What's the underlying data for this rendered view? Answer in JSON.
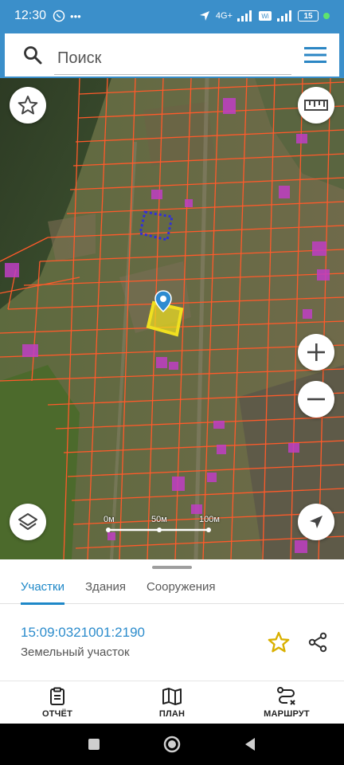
{
  "status_bar": {
    "time": "12:30",
    "network_label": "4G+",
    "battery_level": "15"
  },
  "search": {
    "placeholder": "Поиск"
  },
  "map": {
    "scale": {
      "labels": [
        "0м",
        "50м",
        "100м"
      ]
    },
    "selected_parcel_color": "#f0e020",
    "parcel_border_color": "#ff5a2a",
    "highlight_color": "#c03ec4"
  },
  "tabs": {
    "items": [
      "Участки",
      "Здания",
      "Сооружения"
    ],
    "active": "Участки"
  },
  "parcel": {
    "cadastral_number": "15:09:0321001:2190",
    "type": "Земельный участок"
  },
  "bottom_nav": {
    "report": "ОТЧЁТ",
    "plan": "ПЛАН",
    "route": "МАРШРУТ"
  },
  "icons": {
    "status": [
      "location-icon",
      "signal-icon",
      "wifi-icon",
      "battery-icon"
    ],
    "map": [
      "star-icon",
      "ruler-icon",
      "zoom-in-icon",
      "zoom-out-icon",
      "layers-icon",
      "navigation-icon",
      "map-pin-icon"
    ],
    "sheet": [
      "favorite-star-icon",
      "share-icon"
    ],
    "nav": [
      "report-icon",
      "plan-icon",
      "route-icon"
    ]
  }
}
